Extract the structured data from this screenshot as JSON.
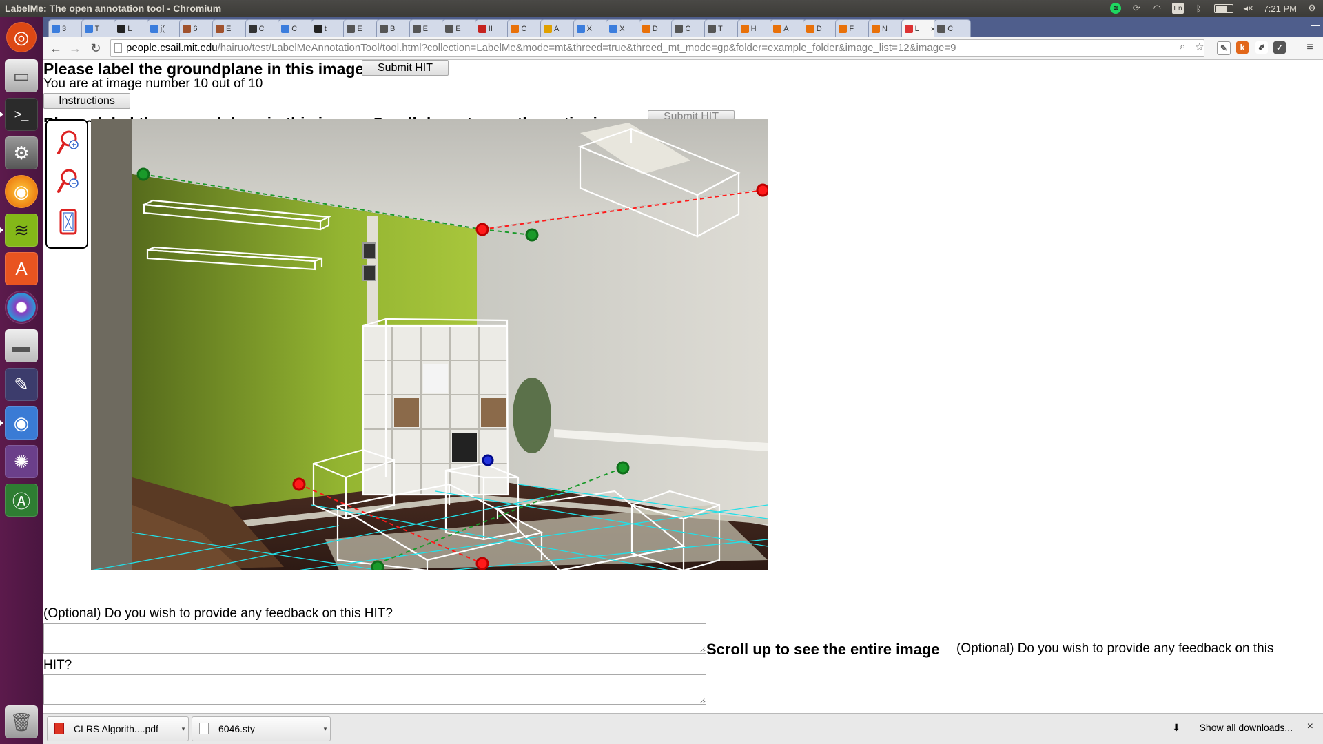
{
  "window": {
    "title": "LabelMe: The open annotation tool - Chromium"
  },
  "tray": {
    "lang": "En",
    "time": "7:21 PM"
  },
  "tabs": [
    {
      "label": "3",
      "color": "#3b7ddd"
    },
    {
      "label": "T",
      "color": "#3b7ddd"
    },
    {
      "label": "L",
      "color": "#222222"
    },
    {
      "label": "j(",
      "color": "#3b7ddd"
    },
    {
      "label": "6",
      "color": "#a0522d"
    },
    {
      "label": "E",
      "color": "#a0522d"
    },
    {
      "label": "C",
      "color": "#333333"
    },
    {
      "label": "C",
      "color": "#3b7ddd"
    },
    {
      "label": "t",
      "color": "#222222"
    },
    {
      "label": "E",
      "color": "#555555"
    },
    {
      "label": "B",
      "color": "#555555"
    },
    {
      "label": "E",
      "color": "#555555"
    },
    {
      "label": "E",
      "color": "#555555"
    },
    {
      "label": "II",
      "color": "#c5221f"
    },
    {
      "label": "C",
      "color": "#e8710a"
    },
    {
      "label": "A",
      "color": "#e0a000"
    },
    {
      "label": "X",
      "color": "#3b7ddd"
    },
    {
      "label": "X",
      "color": "#3b7ddd"
    },
    {
      "label": "D",
      "color": "#e8710a"
    },
    {
      "label": "C",
      "color": "#555555"
    },
    {
      "label": "T",
      "color": "#555555"
    },
    {
      "label": "H",
      "color": "#e8710a"
    },
    {
      "label": "A",
      "color": "#e8710a"
    },
    {
      "label": "D",
      "color": "#e8710a"
    },
    {
      "label": "F",
      "color": "#e8710a"
    },
    {
      "label": "N",
      "color": "#e8710a"
    },
    {
      "label": "L",
      "color": "#d33",
      "active": true
    },
    {
      "label": "C",
      "color": "#555555"
    }
  ],
  "address_bar": {
    "host": "people.csail.mit.edu",
    "path": "/hairuo/test/LabelMeAnnotationTool/tool.html?collection=LabelMe&mode=mt&threed=true&threed_mt_mode=gp&folder=example_folder&image_list=12&image=9"
  },
  "page": {
    "heading": "Please label the groundplane in this image.",
    "submit_label": "Submit HIT",
    "image_number_text": "You are at image number 10 out of 10",
    "instructions_label": "Instructions",
    "second_heading": "Please label the groundplane in this image. Scroll down to see the entire image.",
    "second_submit_label": "Submit HIT",
    "feedback_question": "(Optional) Do you wish to provide any feedback on this HIT?",
    "scroll_up_text": "Scroll up to see the entire image",
    "feedback_question_2a": "(Optional) Do you wish to provide any feedback on this",
    "feedback_question_2b": "HIT?"
  },
  "toolbox": {
    "tools": [
      "zoom-in",
      "zoom-out",
      "fit-image"
    ]
  },
  "downloads": {
    "items": [
      {
        "name": "CLRS Algorith....pdf",
        "type": "pdf"
      },
      {
        "name": "6046.sty",
        "type": "file"
      }
    ],
    "show_all": "Show all downloads...",
    "close": "×"
  },
  "colors": {
    "launcher": "#5c1a4c",
    "tabstrip": "#4f5e8c",
    "annotation_red": "#ff1a1a",
    "annotation_green": "#1a9a2a",
    "annotation_cyan": "#22e0e8"
  }
}
